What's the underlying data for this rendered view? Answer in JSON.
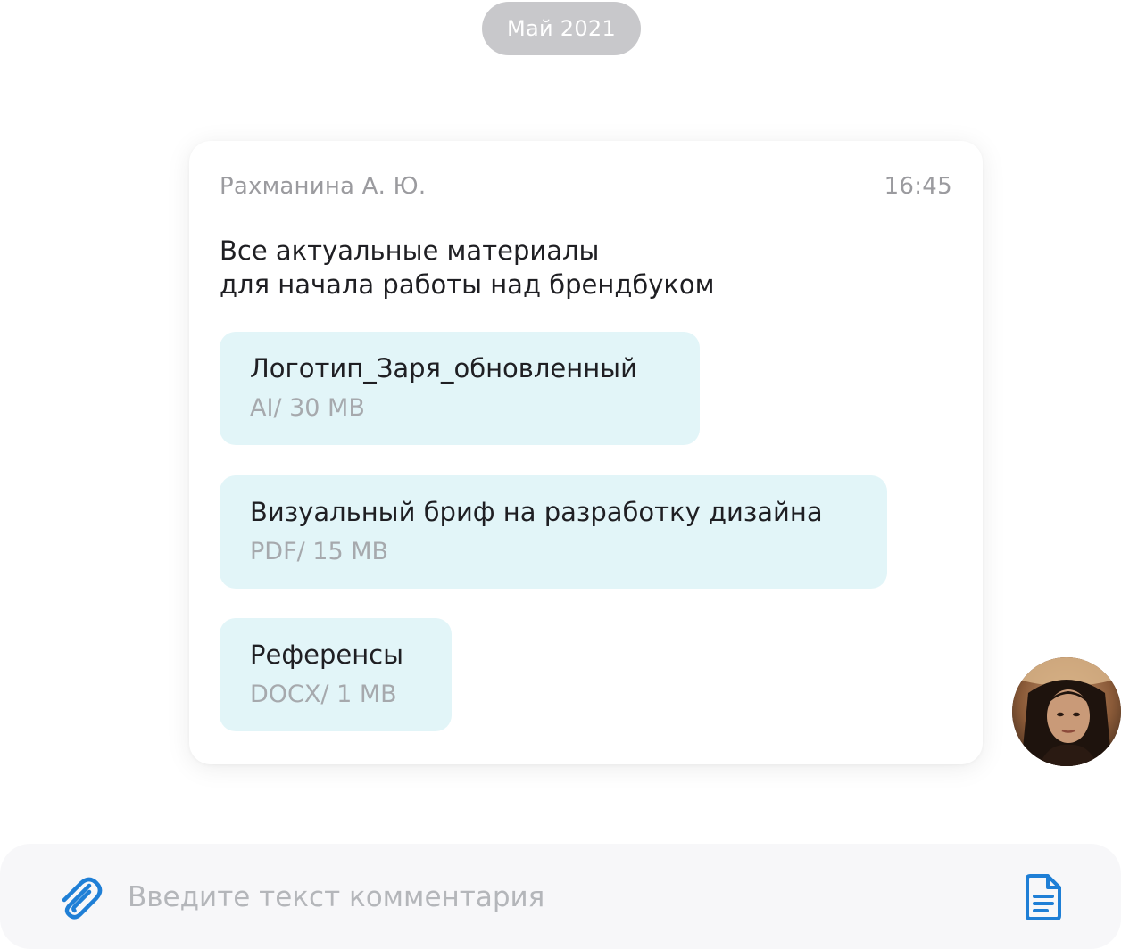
{
  "date_divider": "Май 2021",
  "message": {
    "sender": "Рахманина А. Ю.",
    "time": "16:45",
    "text_lines": [
      "Все актуальные материалы",
      "для начала работы над брендбуком"
    ],
    "attachments": [
      {
        "name": "Логотип_Заря_обновленный",
        "meta": "AI/ 30 MB"
      },
      {
        "name": "Визуальный бриф на разработку дизайна",
        "meta": "PDF/ 15 MB"
      },
      {
        "name": "Референсы",
        "meta": "DOCX/ 1 MB"
      }
    ]
  },
  "composer": {
    "placeholder": "Введите текст комментария",
    "attach_icon": "paperclip-icon",
    "document_icon": "document-icon"
  },
  "colors": {
    "accent": "#1f7fd6",
    "attachment_bg": "#e2f5f8",
    "date_pill_bg": "#c8c8cb"
  }
}
